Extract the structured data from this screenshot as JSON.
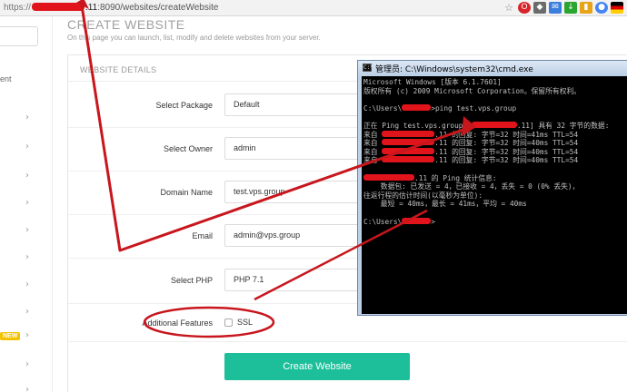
{
  "browser": {
    "protocol": "https://",
    "host_suffix": ".11",
    "port_path": ":8090/websites/createWebsite",
    "icons": [
      "star-icon",
      "opera-icon",
      "extension-icon",
      "mail-icon",
      "download-icon",
      "bookmark-icon",
      "chrome-icon",
      "flag-icon"
    ]
  },
  "sidebar": {
    "partial_label": "ent",
    "new_badge": "NEW",
    "arrow": "›"
  },
  "page": {
    "title": "CREATE WEBSITE",
    "subtitle": "On this page you can launch, list, modify and delete websites from your server."
  },
  "form": {
    "heading": "WEBSITE DETAILS",
    "package_label": "Select Package",
    "package_value": "Default",
    "owner_label": "Select Owner",
    "owner_value": "admin",
    "domain_label": "Domain Name",
    "domain_value": "test.vps.group",
    "email_label": "Email",
    "email_value": "admin@vps.group",
    "php_label": "Select PHP",
    "php_value": "PHP 7.1",
    "features_label": "Additional Features",
    "ssl_label": "SSL",
    "submit_label": "Create Website"
  },
  "cmd": {
    "title": "管理员: C:\\Windows\\system32\\cmd.exe",
    "icon_text": "C:\\",
    "lines": {
      "l1": "Microsoft Windows [版本 6.1.7601]",
      "l2": "版权所有 (c) 2009 Microsoft Corporation。保留所有权利。",
      "l3a": "C:\\Users\\",
      "l3b": ">ping test.vps.group",
      "l4a": "正在 Ping test.vps.group [",
      "l4b": ".11] 具有 32 字节的数据:",
      "reply_a": "来自 ",
      "reply_1b": ".11 的回复: 字节=32 时间=41ms TTL=54",
      "reply_2b": ".11 的回复: 字节=32 时间=40ms TTL=54",
      "reply_3b": ".11 的回复: 字节=32 时间=40ms TTL=54",
      "reply_4b": ".11 的回复: 字节=32 时间=40ms TTL=54",
      "stats_b": ".11 的 Ping 统计信息:",
      "stats_packets": "    数据包: 已发送 = 4，已接收 = 4，丢失 = 0 (0% 丢失)，",
      "stats_rtt": "往返行程的估计时间(以毫秒为单位):",
      "stats_times": "    最短 = 40ms，最长 = 41ms，平均 = 40ms",
      "prompt_a": "C:\\Users\\",
      "prompt_b": ">"
    }
  },
  "annotation": {
    "arrow_color": "#c8161d",
    "ellipse_color": "#c8161d"
  }
}
